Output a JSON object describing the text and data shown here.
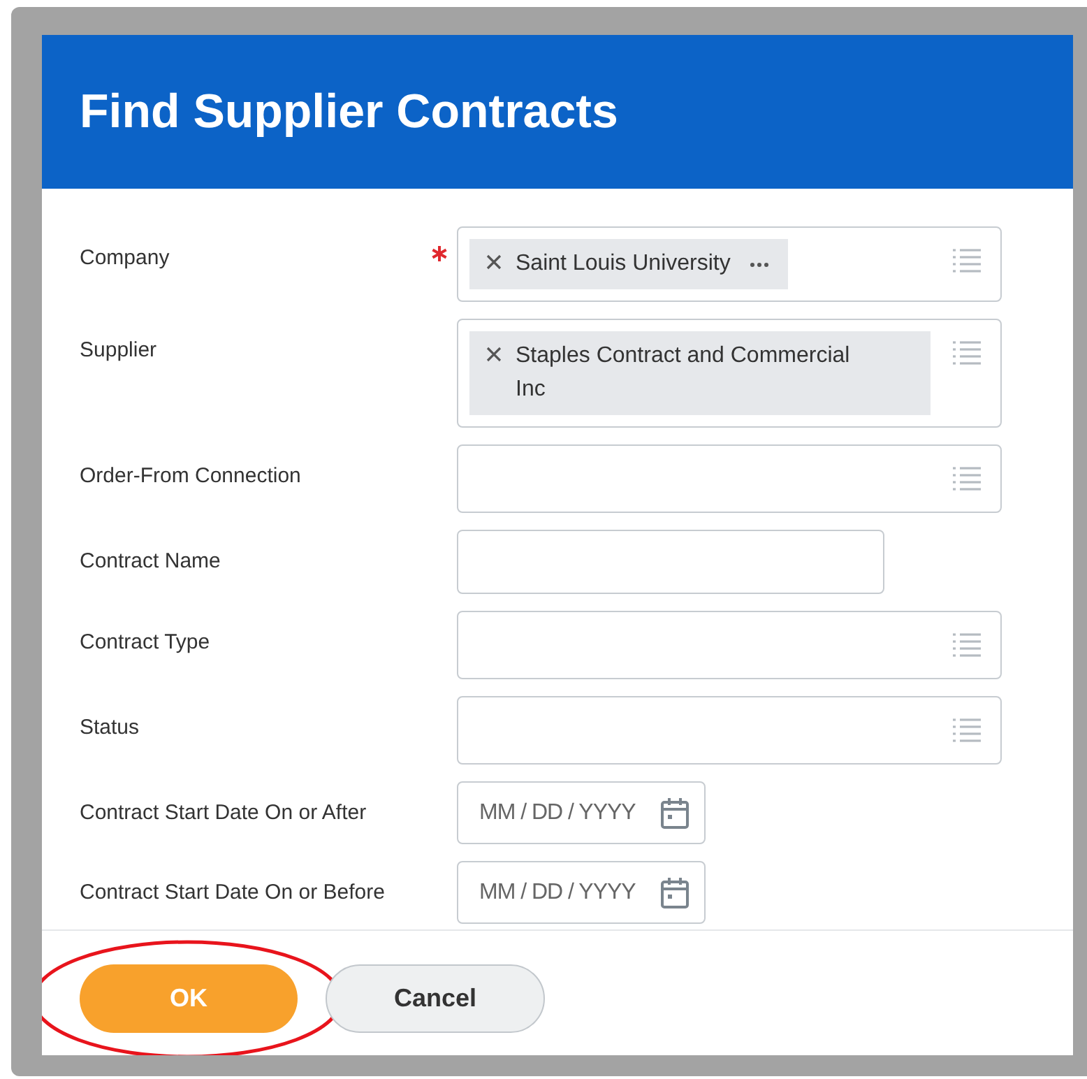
{
  "dialog": {
    "title": "Find Supplier Contracts"
  },
  "fields": [
    {
      "label": "Company",
      "kind": "multiselect",
      "required": true,
      "chips": [
        {
          "text": "Saint Louis University",
          "has_menu": true
        }
      ]
    },
    {
      "label": "Supplier",
      "kind": "multiselect",
      "required": false,
      "chips": [
        {
          "text": "Staples Contract and Commercial Inc",
          "has_menu": false
        }
      ]
    },
    {
      "label": "Order-From Connection",
      "kind": "multiselect",
      "required": false
    },
    {
      "label": "Contract Name",
      "kind": "text",
      "required": false
    },
    {
      "label": "Contract Type",
      "kind": "multiselect",
      "required": false
    },
    {
      "label": "Status",
      "kind": "multiselect",
      "required": false
    },
    {
      "label": "Contract Start Date On or After",
      "kind": "date",
      "required": false,
      "placeholder": "MM / DD / YYYY"
    },
    {
      "label": "Contract Start Date On or Before",
      "kind": "date",
      "required": false,
      "placeholder": "MM / DD / YYYY"
    }
  ],
  "buttons": [
    {
      "label": "OK",
      "kind": "primary",
      "highlighted": true
    },
    {
      "label": "Cancel",
      "kind": "secondary",
      "highlighted": false
    }
  ]
}
